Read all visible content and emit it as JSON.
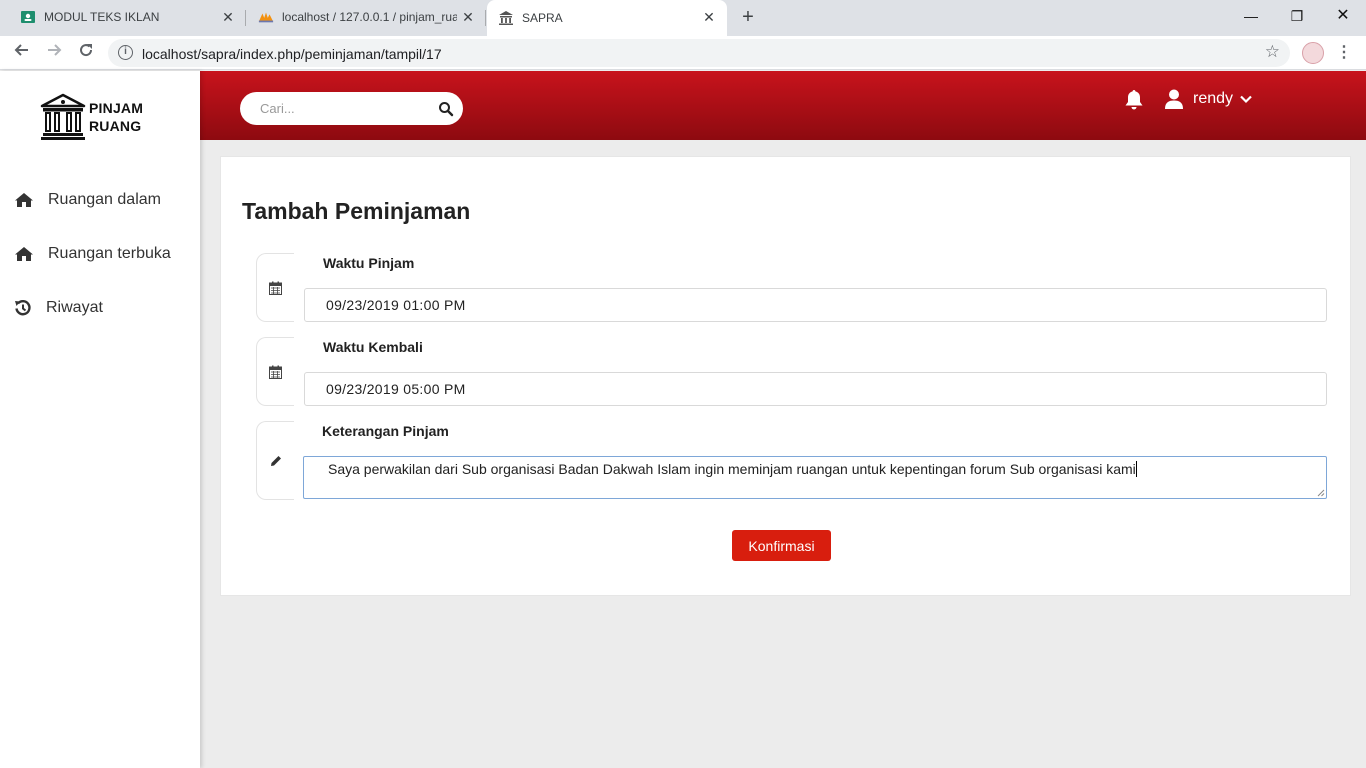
{
  "browser": {
    "tabs": [
      {
        "title": "MODUL TEKS IKLAN",
        "icon": "classroom-icon"
      },
      {
        "title": "localhost / 127.0.0.1 / pinjam_rua",
        "icon": "phpmyadmin-icon"
      },
      {
        "title": "SAPRA",
        "icon": "bank-icon"
      }
    ],
    "url": "localhost/sapra/index.php/peminjaman/tampil/17"
  },
  "brand": {
    "line1": "PINJAM",
    "line2": "RUANG"
  },
  "sidebar": {
    "items": [
      {
        "label": "Ruangan dalam",
        "icon": "home-icon"
      },
      {
        "label": "Ruangan terbuka",
        "icon": "home-icon"
      },
      {
        "label": "Riwayat",
        "icon": "history-icon"
      }
    ]
  },
  "topbar": {
    "search_placeholder": "Cari...",
    "username": "rendy"
  },
  "form": {
    "title": "Tambah Peminjaman",
    "waktu_pinjam_label": "Waktu Pinjam",
    "waktu_pinjam_value": "09/23/2019 01:00 PM",
    "waktu_kembali_label": "Waktu Kembali",
    "waktu_kembali_value": "09/23/2019 05:00 PM",
    "keterangan_label": "Keterangan Pinjam",
    "keterangan_value": "Saya perwakilan dari Sub organisasi Badan Dakwah Islam ingin meminjam ruangan untuk kepentingan forum Sub organisasi kami",
    "submit_label": "Konfirmasi"
  },
  "colors": {
    "header_top": "#c8131c",
    "header_bottom": "#8d0a10",
    "button": "#d81e0e"
  }
}
